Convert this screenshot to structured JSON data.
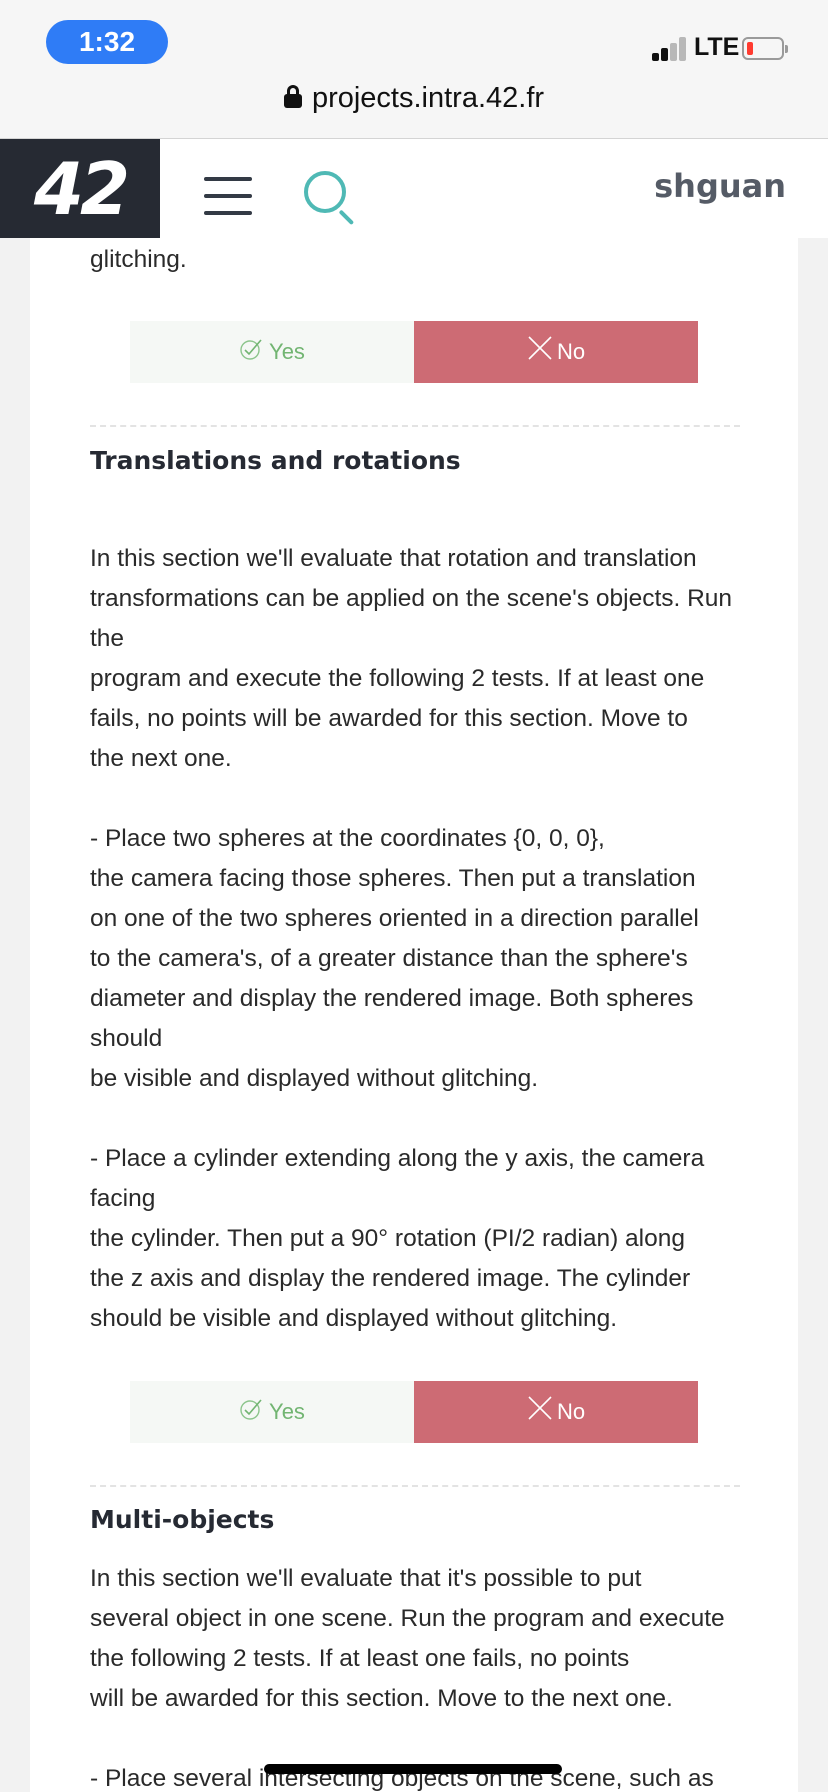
{
  "status_bar": {
    "time": "1:32",
    "network": "LTE",
    "battery_level_percent": 10
  },
  "browser": {
    "url": "projects.intra.42.fr"
  },
  "header": {
    "logo": "42",
    "username": "shguan"
  },
  "content": {
    "prev_tail": "glitching.",
    "buttons": {
      "yes_label": "Yes",
      "no_label": "No"
    },
    "section1": {
      "title": "Translations and rotations",
      "body": "In this section we'll evaluate that rotation and translation\ntransformations can be applied on the scene's objects. Run\nthe\nprogram and execute the following 2 tests. If at least one\nfails, no points will be awarded for this section. Move to\nthe next one.\n\n- Place two spheres at the coordinates {0, 0, 0},\nthe camera facing those spheres. Then put a translation\non one of the two spheres oriented in a direction parallel\nto the camera's, of a greater distance than the sphere's\ndiameter and display the rendered image. Both spheres\nshould\nbe visible and displayed without glitching.\n\n- Place a cylinder extending along the y axis, the camera\nfacing\nthe cylinder. Then put a 90° rotation (PI/2 radian) along\nthe z axis and display the rendered image. The cylinder\nshould be visible and displayed without glitching."
    },
    "section2": {
      "title": "Multi-objects",
      "body": "In this section we'll evaluate that it's possible to put\nseveral object in one scene. Run the program and execute\nthe following 2 tests. If at least one fails, no points\nwill be awarded for this section. Move to the next one.\n\n- Place several intersecting objects on the scene, such as"
    }
  }
}
